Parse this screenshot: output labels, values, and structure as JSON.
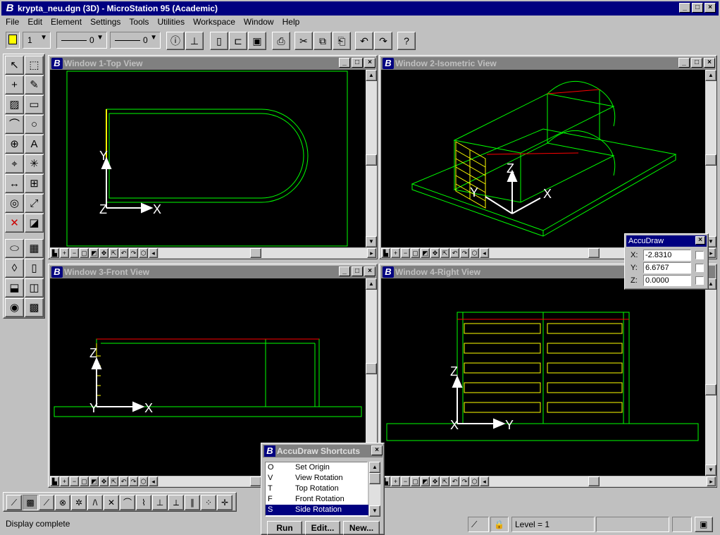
{
  "app": {
    "title": "krypta_neu.dgn (3D) - MicroStation 95 (Academic)",
    "logo_icon": "microstation-logo-icon",
    "caption_buttons": [
      "_",
      "□",
      "×"
    ]
  },
  "menu": [
    "File",
    "Edit",
    "Element",
    "Settings",
    "Tools",
    "Utilities",
    "Workspace",
    "Window",
    "Help"
  ],
  "attributes": {
    "active_color": "#ffff00",
    "level_value": "1",
    "line_style_value": "0",
    "line_weight_value": "0"
  },
  "toolbar_icons": [
    "info-icon",
    "measure-icon",
    "new-file-icon",
    "open-file-icon",
    "save-icon",
    "print-icon",
    "cut-icon",
    "copy-icon",
    "paste-icon",
    "undo-icon",
    "redo-icon",
    "help-icon"
  ],
  "views": [
    {
      "title": "Window 1-Top View"
    },
    {
      "title": "Window 2-Isometric View"
    },
    {
      "title": "Window 3-Front View"
    },
    {
      "title": "Window 4-Right View"
    }
  ],
  "view_axis_labels": {
    "top": {
      "a": "Y",
      "b": "Z",
      "c": "X"
    },
    "iso": {
      "a": "Z",
      "b": "Y",
      "c": "X"
    },
    "front": {
      "a": "Z",
      "b": "Y",
      "c": "X"
    },
    "right": {
      "a": "Z",
      "b": "X",
      "c": "Y"
    }
  },
  "accudraw": {
    "title": "AccuDraw",
    "x_label": "X:",
    "x_value": "-2.8310",
    "y_label": "Y:",
    "y_value": "6.6767",
    "z_label": "Z:",
    "z_value": "0.0000"
  },
  "shortcuts": {
    "title": "AccuDraw Shortcuts",
    "items": [
      {
        "key": "O",
        "name": "Set Origin"
      },
      {
        "key": "V",
        "name": "View Rotation"
      },
      {
        "key": "T",
        "name": "Top Rotation"
      },
      {
        "key": "F",
        "name": "Front Rotation"
      },
      {
        "key": "S",
        "name": "Side Rotation"
      }
    ],
    "selected": "S",
    "run_label": "Run",
    "edit_label": "Edit...",
    "new_label": "New..."
  },
  "status": {
    "message": "Display complete",
    "level": "Level = 1"
  },
  "colors": {
    "geometry": "#00ff00",
    "highlight": "#ffff00",
    "edge": "#ff0000",
    "title_active": "#000080",
    "title_inactive": "#808080"
  }
}
